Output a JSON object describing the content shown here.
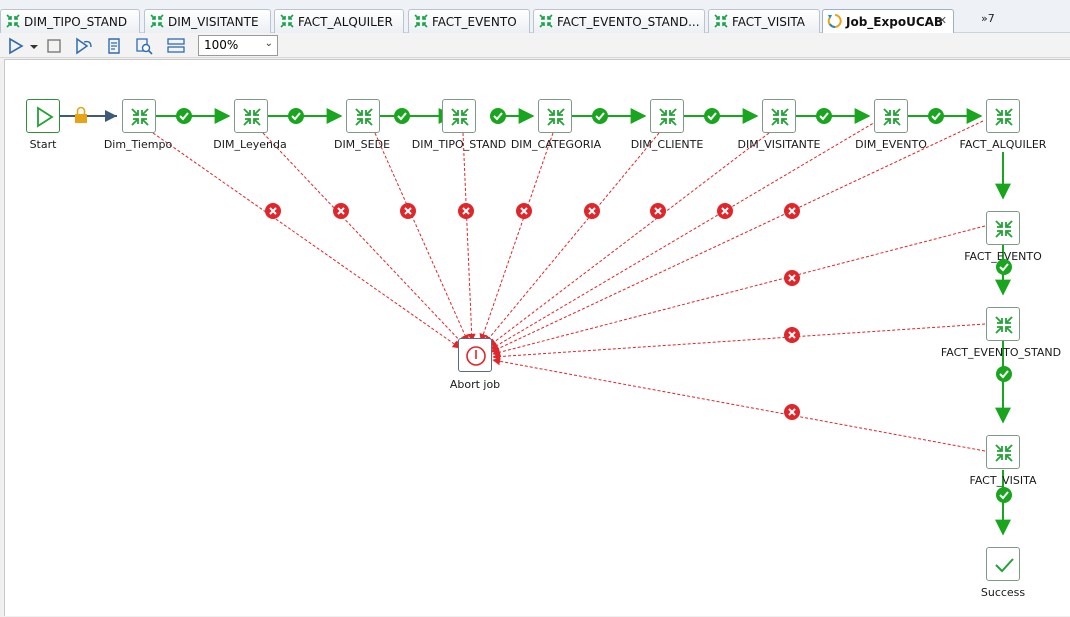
{
  "tabs": [
    {
      "label": "DIM_TIPO_STAND",
      "active": false,
      "icon": "component-icon"
    },
    {
      "label": "DIM_VISITANTE",
      "active": false,
      "icon": "component-icon"
    },
    {
      "label": "FACT_ALQUILER",
      "active": false,
      "icon": "component-icon"
    },
    {
      "label": "FACT_EVENTO",
      "active": false,
      "icon": "component-icon"
    },
    {
      "label": "FACT_EVENTO_STAND...",
      "active": false,
      "icon": "component-icon"
    },
    {
      "label": "FACT_VISITA",
      "active": false,
      "icon": "component-icon"
    },
    {
      "label": "Job_ExpoUCAB",
      "active": true,
      "icon": "job-icon",
      "close": "✕"
    }
  ],
  "tab_overflow": "»7",
  "toolbar": {
    "run_icon": "play-icon",
    "dropdown_icon": "chevron-down-icon",
    "stop_icon": "stop-icon",
    "step_icon": "step-into-icon",
    "script_icon": "script-icon",
    "search_icon": "search-db-icon",
    "layout_icon": "layout-icon",
    "zoom": "100%"
  },
  "nodes": {
    "start": {
      "label": "Start",
      "icon": "play-icon"
    },
    "dim_tiempo": {
      "label": "Dim_Tiempo"
    },
    "dim_leyenda": {
      "label": "DIM_Leyenda"
    },
    "dim_sede": {
      "label": "DIM_SEDE"
    },
    "dim_tipo_stand": {
      "label": "DIM_TIPO_STAND"
    },
    "dim_categoria": {
      "label": "DIM_CATEGORIA"
    },
    "dim_cliente": {
      "label": "DIM_CLIENTE"
    },
    "dim_visitante": {
      "label": "DIM_VISITANTE"
    },
    "dim_evento": {
      "label": "DIM_EVENTO"
    },
    "fact_alquiler": {
      "label": "FACT_ALQUILER"
    },
    "fact_evento": {
      "label": "FACT_EVENTO"
    },
    "fact_evento_stand": {
      "label": "FACT_EVENTO_STAND"
    },
    "fact_visita": {
      "label": "FACT_VISITA"
    },
    "abort": {
      "label": "Abort job",
      "icon": "abort-icon"
    },
    "success": {
      "label": "Success",
      "icon": "checkmark-icon"
    }
  },
  "colors": {
    "success_hop": "#1aa51f",
    "error_hop": "#e0262b",
    "unconditional_hop": "#3d5a78",
    "lock": "#e8a317",
    "node_border": "#7e9b88"
  }
}
